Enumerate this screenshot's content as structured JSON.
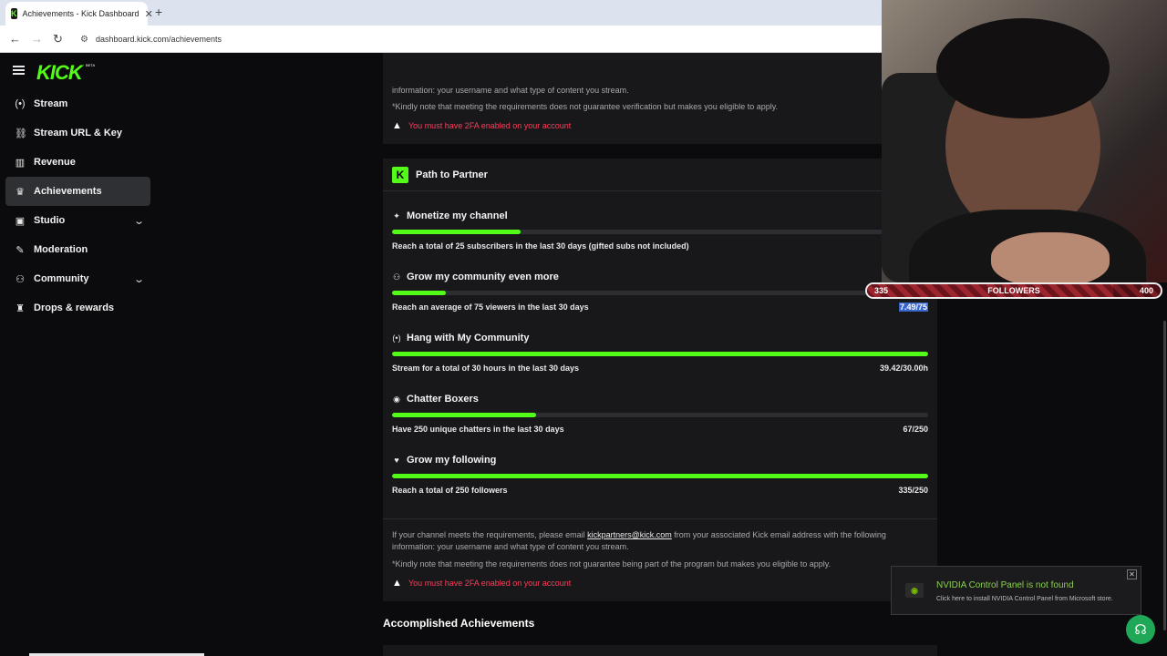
{
  "browser": {
    "tab_title": "Achievements - Kick Dashboard",
    "tab_favicon": "K",
    "tab_close": "✕",
    "new_tab": "+",
    "url": "dashboard.kick.com/achievements"
  },
  "brand": {
    "logo": "KICK",
    "beta": "BETA",
    "accent": "#53fc18"
  },
  "sidebar": {
    "items": [
      {
        "label": "Stream",
        "icon": "broadcast-icon",
        "glyph": "(•)"
      },
      {
        "label": "Stream URL & Key",
        "icon": "link-icon",
        "glyph": "⛓"
      },
      {
        "label": "Revenue",
        "icon": "chart-icon",
        "glyph": "▥"
      },
      {
        "label": "Achievements",
        "icon": "trophy-icon",
        "glyph": "♛"
      },
      {
        "label": "Studio",
        "icon": "studio-icon",
        "glyph": "▣"
      },
      {
        "label": "Moderation",
        "icon": "wrench-icon",
        "glyph": "✎"
      },
      {
        "label": "Community",
        "icon": "users-icon",
        "glyph": "⚇"
      },
      {
        "label": "Drops & rewards",
        "icon": "gift-icon",
        "glyph": "♜"
      }
    ],
    "active": "Achievements"
  },
  "top_panel": {
    "line1": "information: your username and what type of content you stream.",
    "line2": "*Kindly note that meeting the requirements does not guarantee verification but makes you eligible to apply.",
    "warning": "You must have 2FA enabled on your account"
  },
  "path_to_partner": {
    "title": "Path to Partner",
    "goals": [
      {
        "title": "Monetize my channel",
        "icon": "sparkle-icon",
        "glyph": "✦",
        "progress": 0.24,
        "description": "Reach a total of 25 subscribers in the last 30 days (gifted subs not included)",
        "value": ""
      },
      {
        "title": "Grow my community even more",
        "icon": "community-icon",
        "glyph": "⚇",
        "progress": 0.1,
        "description": "Reach an average of 75 viewers in the last 30 days",
        "value": "7.49/75"
      },
      {
        "title": "Hang with My Community",
        "icon": "broadcast-icon",
        "glyph": "(•)",
        "progress": 1.0,
        "description": "Stream for a total of 30 hours in the last 30 days",
        "value": "39.42/30.00h"
      },
      {
        "title": "Chatter Boxers",
        "icon": "chat-icon",
        "glyph": "◉",
        "progress": 0.268,
        "description": "Have 250 unique chatters in the last 30 days",
        "value": "67/250"
      },
      {
        "title": "Grow my following",
        "icon": "heart-icon",
        "glyph": "♥",
        "progress": 1.0,
        "description": "Reach a total of 250 followers",
        "value": "335/250"
      }
    ],
    "footer_pre": "If your channel meets the requirements, please email ",
    "footer_email": "kickpartners@kick.com",
    "footer_post": " from your associated Kick email address with the following information: your username and what type of content you stream.",
    "footer_note": "*Kindly note that meeting the requirements does not guarantee being part of the program but makes you eligible to apply.",
    "warning": "You must have 2FA enabled on your account"
  },
  "accomplished_title": "Accomplished Achievements",
  "overlay": {
    "followers_label": "FOLLOWERS",
    "followers_current": "335",
    "followers_goal": "400",
    "followers_progress": 0.8375
  },
  "toast": {
    "title": "NVIDIA Control Panel is not found",
    "subtitle": "Click here to install NVIDIA Control Panel from Microsoft store.",
    "close": "✕"
  }
}
